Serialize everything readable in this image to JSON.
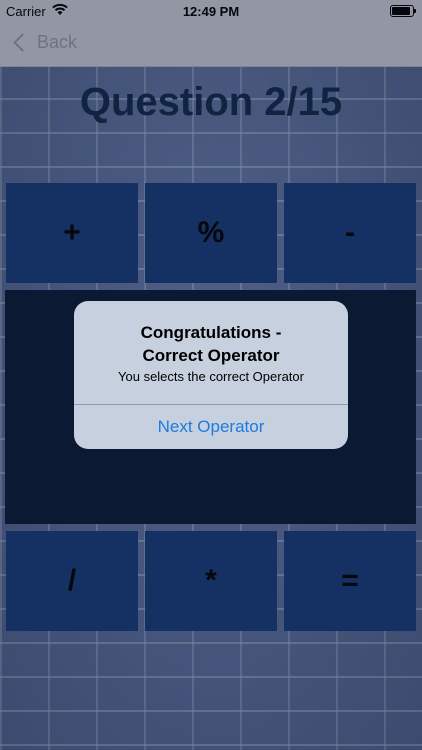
{
  "status": {
    "carrier": "Carrier",
    "time": "12:49 PM"
  },
  "nav": {
    "back_label": "Back"
  },
  "quiz": {
    "title": "Question 2/15"
  },
  "operators": {
    "top": [
      "+",
      "%",
      "-"
    ],
    "bottom": [
      "/",
      "*",
      "="
    ]
  },
  "alert": {
    "title_line1": "Congratulations -",
    "title_line2": "Correct Operator",
    "message": "You selects the correct Operator",
    "button": "Next Operator"
  },
  "colors": {
    "button_bg": "#153b78",
    "panel_bg": "#081a35",
    "alert_button": "#1c7ce0",
    "title": "#0f2748"
  }
}
